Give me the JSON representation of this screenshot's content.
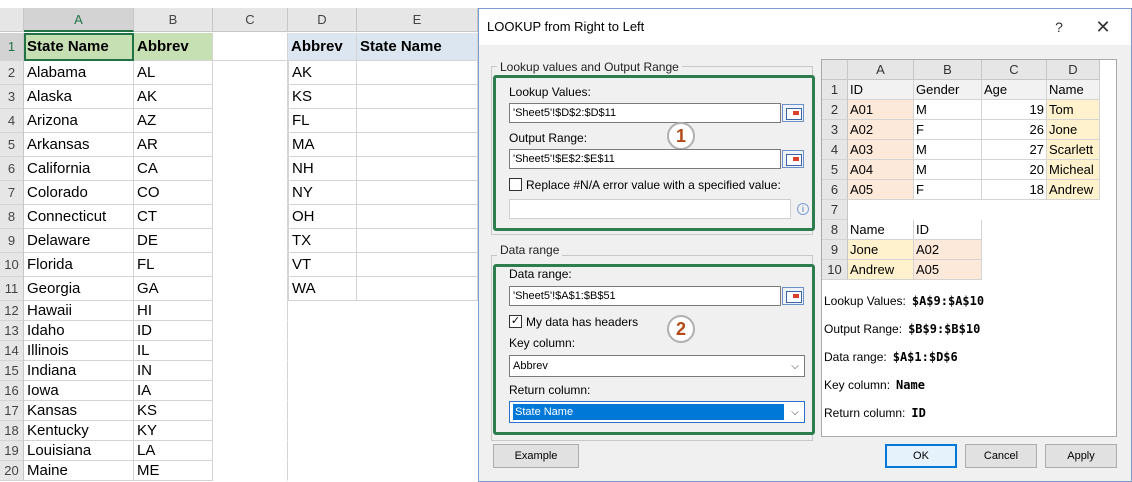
{
  "sheet": {
    "columns": [
      "A",
      "B",
      "C",
      "D",
      "E"
    ],
    "rows": [
      "1",
      "2",
      "3",
      "4",
      "5",
      "6",
      "7",
      "8",
      "9",
      "10",
      "11",
      "12",
      "13",
      "14",
      "15",
      "16",
      "17",
      "18",
      "19",
      "20"
    ],
    "header_a": "State Name",
    "header_b": "Abbrev",
    "states": [
      [
        "Alabama",
        "AL"
      ],
      [
        "Alaska",
        "AK"
      ],
      [
        "Arizona",
        "AZ"
      ],
      [
        "Arkansas",
        "AR"
      ],
      [
        "California",
        "CA"
      ],
      [
        "Colorado",
        "CO"
      ],
      [
        "Connecticut",
        "CT"
      ],
      [
        "Delaware",
        "DE"
      ],
      [
        "Florida",
        "FL"
      ],
      [
        "Georgia",
        "GA"
      ],
      [
        "Hawaii",
        "HI"
      ],
      [
        "Idaho",
        "ID"
      ],
      [
        "Illinois",
        "IL"
      ],
      [
        "Indiana",
        "IN"
      ],
      [
        "Iowa",
        "IA"
      ],
      [
        "Kansas",
        "KS"
      ],
      [
        "Kentucky",
        "KY"
      ],
      [
        "Louisiana",
        "LA"
      ],
      [
        "Maine",
        "ME"
      ]
    ],
    "header_d": "Abbrev",
    "header_e": "State Name",
    "lookups": [
      "AK",
      "KS",
      "FL",
      "MA",
      "NH",
      "NY",
      "OH",
      "TX",
      "VT",
      "WA"
    ]
  },
  "dialog": {
    "title": "LOOKUP from Right to Left",
    "help": "?",
    "close": "✕",
    "group1_title": "Lookup values and Output Range",
    "lookup_values_label": "Lookup Values:",
    "lookup_values": "'Sheet5'!$D$2:$D$11",
    "output_range_label": "Output Range:",
    "output_range": "'Sheet5'!$E$2:$E$11",
    "replace_label": "Replace #N/A error value with a specified value:",
    "replace_value": "",
    "badge1": "1",
    "group2_title": "Data range",
    "data_range_label": "Data range:",
    "data_range": "'Sheet5'!$A$1:$B$51",
    "headers_label": "My data has headers",
    "headers_checked": "✓",
    "badge2": "2",
    "key_column_label": "Key column:",
    "key_column": "Abbrev",
    "return_column_label": "Return column:",
    "return_column": "State Name",
    "example_btn": "Example",
    "ok_btn": "OK",
    "cancel_btn": "Cancel",
    "apply_btn": "Apply"
  },
  "preview": {
    "cols": [
      "A",
      "B",
      "C",
      "D"
    ],
    "rows": [
      "1",
      "2",
      "3",
      "4",
      "5",
      "6",
      "7",
      "8",
      "9",
      "10"
    ],
    "table_header": [
      "ID",
      "Gender",
      "Age",
      "Name"
    ],
    "table": [
      [
        "A01",
        "M",
        "19",
        "Tom"
      ],
      [
        "A02",
        "F",
        "26",
        "Jone"
      ],
      [
        "A03",
        "M",
        "27",
        "Scarlett"
      ],
      [
        "A04",
        "M",
        "20",
        "Micheal"
      ],
      [
        "A05",
        "F",
        "18",
        "Andrew"
      ]
    ],
    "lookup_header": [
      "Name",
      "ID"
    ],
    "lookup": [
      [
        "Jone",
        "A02"
      ],
      [
        "Andrew",
        "A05"
      ]
    ],
    "info": [
      [
        "Lookup Values:",
        "$A$9:$A$10"
      ],
      [
        "Output Range:",
        "$B$9:$B$10"
      ],
      [
        "Data range:",
        "$A$1:$D$6"
      ],
      [
        "Key column:",
        "Name"
      ],
      [
        "Return column:",
        "ID"
      ]
    ]
  }
}
